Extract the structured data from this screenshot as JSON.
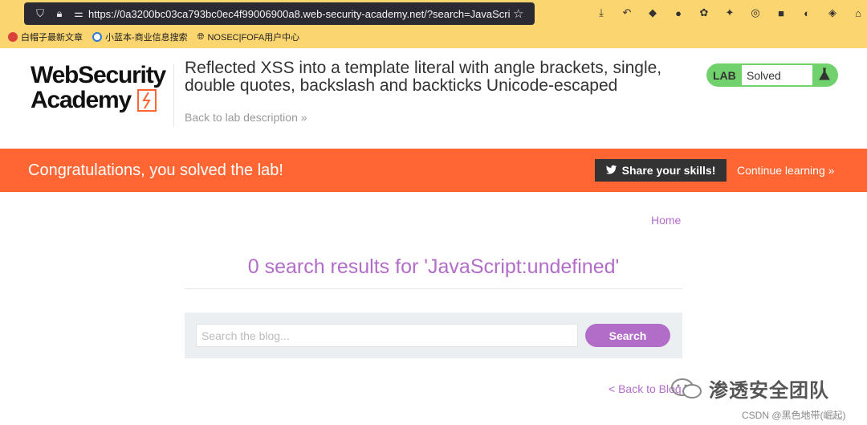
{
  "browser": {
    "url": "https://0a3200bc03ca793bc0ec4f99006900a8.web-security-academy.net/?search=JavaScri",
    "bookmarks": [
      {
        "label": "白帽子最新文章"
      },
      {
        "label": "小蓝本-商业信息搜索"
      },
      {
        "label": "NOSEC|FOFA用户中心"
      }
    ]
  },
  "header": {
    "logo_line1": "WebSecurity",
    "logo_line2": "Academy",
    "title": "Reflected XSS into a template literal with angle brackets, single, double quotes, backslash and backticks Unicode-escaped",
    "back_label": "Back to lab description »",
    "lab_label": "LAB",
    "status": "Solved"
  },
  "banner": {
    "message": "Congratulations, you solved the lab!",
    "share_label": "Share your skills!",
    "continue_label": "Continue learning »"
  },
  "main": {
    "home_label": "Home",
    "results_heading": "0 search results for 'JavaScript:undefined'",
    "search_placeholder": "Search the blog...",
    "search_button": "Search",
    "back_blog_label": "< Back to Blog"
  },
  "watermark": {
    "text": "渗透安全团队",
    "csdn": "CSDN @黑色地带(崛起)"
  },
  "colors": {
    "accent": "#b26dc8",
    "banner": "#ff6633",
    "lab_badge": "#70d16d",
    "chrome": "#fbd56f"
  }
}
